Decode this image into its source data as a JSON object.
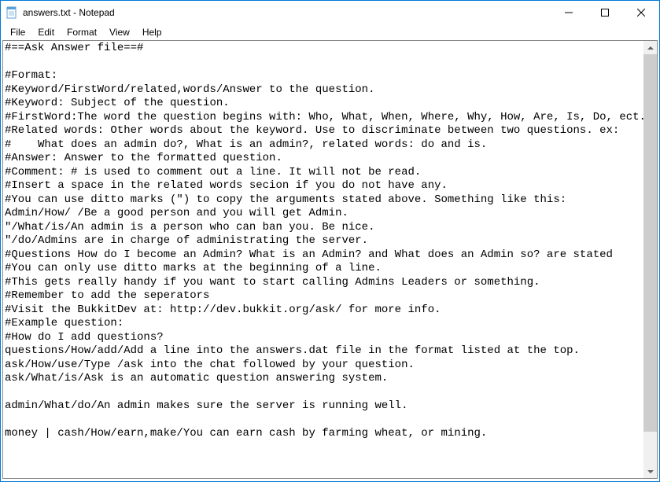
{
  "window": {
    "title": "answers.txt - Notepad"
  },
  "menu": {
    "file": "File",
    "edit": "Edit",
    "format": "Format",
    "view": "View",
    "help": "Help"
  },
  "editor": {
    "content": "#==Ask Answer file==#\n\n#Format:\n#Keyword/FirstWord/related,words/Answer to the question.\n#Keyword: Subject of the question.\n#FirstWord:The word the question begins with: Who, What, When, Where, Why, How, Are, Is, Do, ect. Asks what about the keyword.\n#Related words: Other words about the keyword. Use to discriminate between two questions. ex:\n#    What does an admin do?, What is an admin?, related words: do and is.\n#Answer: Answer to the formatted question.\n#Comment: # is used to comment out a line. It will not be read.\n#Insert a space in the related words secion if you do not have any.\n#You can use ditto marks (\") to copy the arguments stated above. Something like this:\nAdmin/How/ /Be a good person and you will get Admin.\n\"/What/is/An admin is a person who can ban you. Be nice.\n\"/do/Admins are in charge of administrating the server.\n#Questions How do I become an Admin? What is an Admin? and What does an Admin so? are stated\n#You can only use ditto marks at the beginning of a line.\n#This gets really handy if you want to start calling Admins Leaders or something.\n#Remember to add the seperators\n#Visit the BukkitDev at: http://dev.bukkit.org/ask/ for more info.\n#Example question:\n#How do I add questions?\nquestions/How/add/Add a line into the answers.dat file in the format listed at the top.\nask/How/use/Type /ask into the chat followed by your question.\nask/What/is/Ask is an automatic question answering system.\n\nadmin/What/do/An admin makes sure the server is running well.\n\nmoney | cash/How/earn,make/You can earn cash by farming wheat, or mining."
  }
}
